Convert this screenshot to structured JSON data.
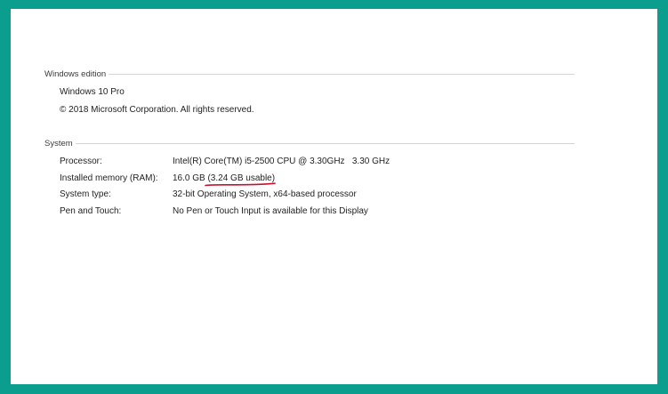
{
  "windows_edition": {
    "header": "Windows edition",
    "edition": "Windows 10 Pro",
    "copyright": "© 2018 Microsoft Corporation. All rights reserved."
  },
  "system": {
    "header": "System",
    "rows": [
      {
        "label": "Processor:",
        "value": "Intel(R) Core(TM) i5-2500 CPU @ 3.30GHz   3.30 GHz"
      },
      {
        "label": "Installed memory (RAM):",
        "value_main": "16.0 GB ",
        "value_usable": "(3.24 GB usable)"
      },
      {
        "label": "System type:",
        "value": "32-bit Operating System, x64-based processor"
      },
      {
        "label": "Pen and Touch:",
        "value": "No Pen or Touch Input is available for this Display"
      }
    ]
  },
  "colors": {
    "frame": "#0b9e8f",
    "annotation": "#c8102e"
  }
}
